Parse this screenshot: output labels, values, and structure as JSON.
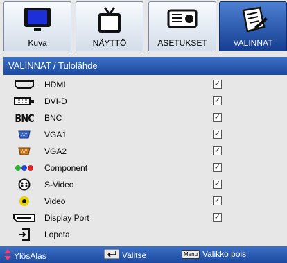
{
  "tabs": [
    {
      "label": "Kuva",
      "icon": "monitor-icon",
      "active": false
    },
    {
      "label": "NÄYTTÖ",
      "icon": "tv-icon",
      "active": false
    },
    {
      "label": "ASETUKSET",
      "icon": "projector-icon",
      "active": false
    },
    {
      "label": "VALINNAT",
      "icon": "notepad-icon",
      "active": true
    }
  ],
  "header": {
    "title": "VALINNAT / Tulolähde"
  },
  "sources": [
    {
      "label": "HDMI",
      "icon": "hdmi-icon",
      "checked": true
    },
    {
      "label": "DVI-D",
      "icon": "dvi-icon",
      "checked": true
    },
    {
      "label": "BNC",
      "icon": "bnc-icon",
      "checked": true
    },
    {
      "label": "VGA1",
      "icon": "vga1-icon",
      "checked": true
    },
    {
      "label": "VGA2",
      "icon": "vga2-icon",
      "checked": true
    },
    {
      "label": "Component",
      "icon": "component-icon",
      "checked": true
    },
    {
      "label": "S-Video",
      "icon": "svideo-icon",
      "checked": true
    },
    {
      "label": "Video",
      "icon": "video-icon",
      "checked": true
    },
    {
      "label": "Display Port",
      "icon": "displayport-icon",
      "checked": true
    },
    {
      "label": "Lopeta",
      "icon": "exit-icon",
      "checked": null
    }
  ],
  "bnc_text": "BNC",
  "footer": {
    "nav": "YlösAlas",
    "select": "Valitse",
    "menu_key": "Menu",
    "exit": "Valikko pois"
  },
  "colors": {
    "accent": "#1c4aa0",
    "vga1": "#3a6ad0",
    "vga2": "#c9781e",
    "video": "#e8d300"
  }
}
